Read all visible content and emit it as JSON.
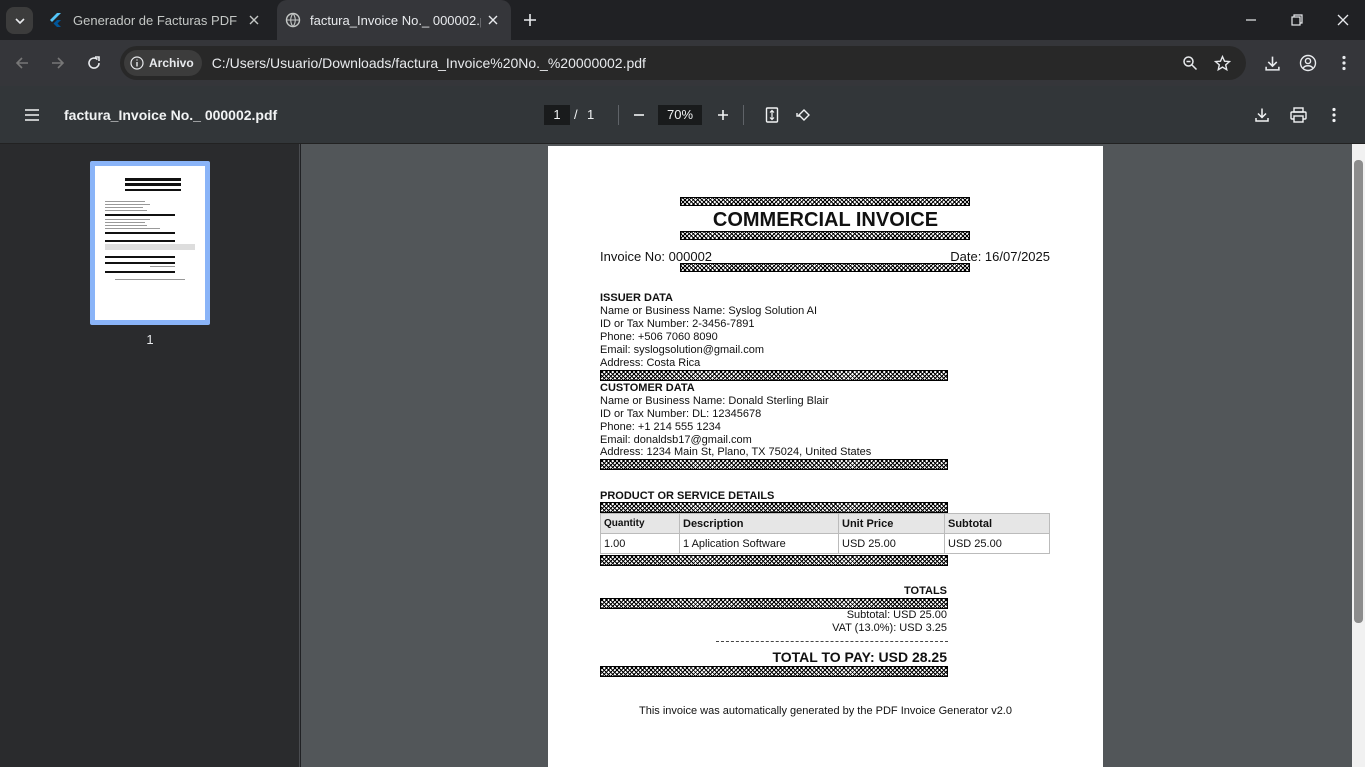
{
  "tabs": [
    {
      "title": "Generador de Facturas PDF",
      "active": false
    },
    {
      "title": "factura_Invoice No._ 000002.pdf",
      "active": true
    }
  ],
  "toolbar": {
    "chip_label": "Archivo",
    "url": "C:/Users/Usuario/Downloads/factura_Invoice%20No._%20000002.pdf"
  },
  "pdf": {
    "filename": "factura_Invoice No._ 000002.pdf",
    "current_page": "1",
    "page_sep": "/",
    "total_pages": "1",
    "zoom": "70%",
    "thumb_label": "1"
  },
  "invoice": {
    "title": "COMMERCIAL INVOICE",
    "invoice_no": "Invoice No: 000002",
    "date": "Date: 16/07/2025",
    "issuer_heading": "ISSUER DATA",
    "issuer": [
      "Name or Business Name: Syslog Solution AI",
      "ID or Tax Number: 2-3456-7891",
      "Phone: +506 7060 8090",
      "Email: syslogsolution@gmail.com",
      "Address: Costa Rica"
    ],
    "customer_heading": "CUSTOMER DATA",
    "customer": [
      "Name or Business Name: Donald Sterling Blair",
      "ID or Tax Number: DL: 12345678",
      "Phone: +1 214 555 1234",
      "Email: donaldsb17@gmail.com",
      "Address: 1234 Main St, Plano, TX 75024, United States"
    ],
    "details_heading": "PRODUCT OR SERVICE DETAILS",
    "table_headers": [
      "Quantity",
      "Description",
      "Unit Price",
      "Subtotal"
    ],
    "table_rows": [
      [
        "1.00",
        "1 Aplication Software",
        "USD 25.00",
        "USD 25.00"
      ]
    ],
    "totals_heading": "TOTALS",
    "subtotal": "Subtotal: USD 25.00",
    "vat": "VAT (13.0%): USD 3.25",
    "total": "TOTAL TO PAY: USD 28.25",
    "footer": "This invoice was automatically generated by the PDF Invoice Generator v2.0"
  },
  "colors": {
    "tab_bg": "#202124",
    "toolbar_bg": "#35363a",
    "pdfbar_bg": "#323639",
    "viewer_bg": "#525659",
    "thumb_highlight": "#8ab4f8"
  },
  "icons": [
    "tab-search-icon",
    "flutter-icon",
    "globe-icon",
    "close-icon",
    "plus-icon",
    "minimize-icon",
    "restore-icon",
    "back-icon",
    "forward-icon",
    "reload-icon",
    "info-icon",
    "zoom-icon",
    "star-icon",
    "download-icon",
    "profile-icon",
    "more-icon",
    "hamburger-icon",
    "minus-icon",
    "fit-page-icon",
    "rotate-icon",
    "print-icon"
  ]
}
